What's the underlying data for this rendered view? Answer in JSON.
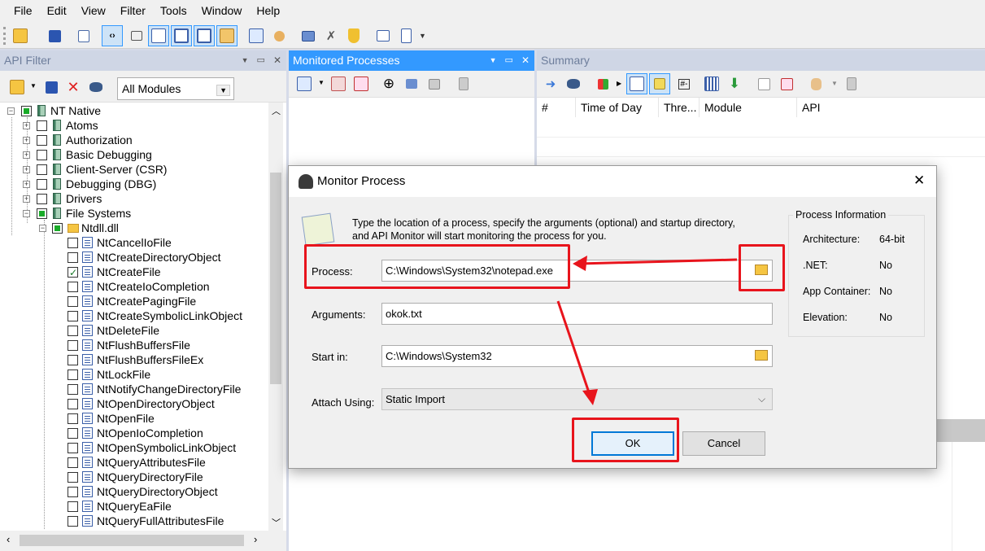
{
  "menu": [
    "File",
    "Edit",
    "View",
    "Filter",
    "Tools",
    "Window",
    "Help"
  ],
  "panes": {
    "api_filter": {
      "title": "API Filter",
      "module_select": "All Modules"
    },
    "monitored": {
      "title": "Monitored Processes"
    },
    "summary": {
      "title": "Summary",
      "columns": [
        "#",
        "Time of Day",
        "Thre...",
        "Module",
        "API"
      ]
    }
  },
  "header_buttons": {
    "dropdown": "▼",
    "pin": "📌",
    "close": "✕"
  },
  "tree": {
    "root": "NT Native",
    "categories": [
      "Atoms",
      "Authorization",
      "Basic Debugging",
      "Client-Server (CSR)",
      "Debugging (DBG)",
      "Drivers",
      "File Systems"
    ],
    "dll": "Ntdll.dll",
    "functions": [
      "NtCancelIoFile",
      "NtCreateDirectoryObject",
      "NtCreateFile",
      "NtCreateIoCompletion",
      "NtCreatePagingFile",
      "NtCreateSymbolicLinkObject",
      "NtDeleteFile",
      "NtFlushBuffersFile",
      "NtFlushBuffersFileEx",
      "NtLockFile",
      "NtNotifyChangeDirectoryFile",
      "NtOpenDirectoryObject",
      "NtOpenFile",
      "NtOpenIoCompletion",
      "NtOpenSymbolicLinkObject",
      "NtQueryAttributesFile",
      "NtQueryDirectoryFile",
      "NtQueryDirectoryObject",
      "NtQueryEaFile",
      "NtQueryFullAttributesFile"
    ],
    "checked_function": "NtCreateFile"
  },
  "dialog": {
    "title": "Monitor Process",
    "close": "✕",
    "description_line1": "Type the location of a process, specify the arguments (optional) and startup directory,",
    "description_line2": "and API Monitor will start monitoring the process for you.",
    "process_label": "Process:",
    "process_value": "C:\\Windows\\System32\\notepad.exe",
    "arguments_label": "Arguments:",
    "arguments_value": "okok.txt",
    "start_in_label": "Start in:",
    "start_in_value": "C:\\Windows\\System32",
    "attach_label": "Attach Using:",
    "attach_value": "Static Import",
    "ok": "OK",
    "cancel": "Cancel",
    "info": {
      "title": "Process Information",
      "rows": [
        {
          "label": "Architecture:",
          "value": "64-bit"
        },
        {
          "label": ".NET:",
          "value": "No"
        },
        {
          "label": "App Container:",
          "value": "No"
        },
        {
          "label": "Elevation:",
          "value": "No"
        }
      ]
    }
  },
  "annotation_color": "#e8141c"
}
